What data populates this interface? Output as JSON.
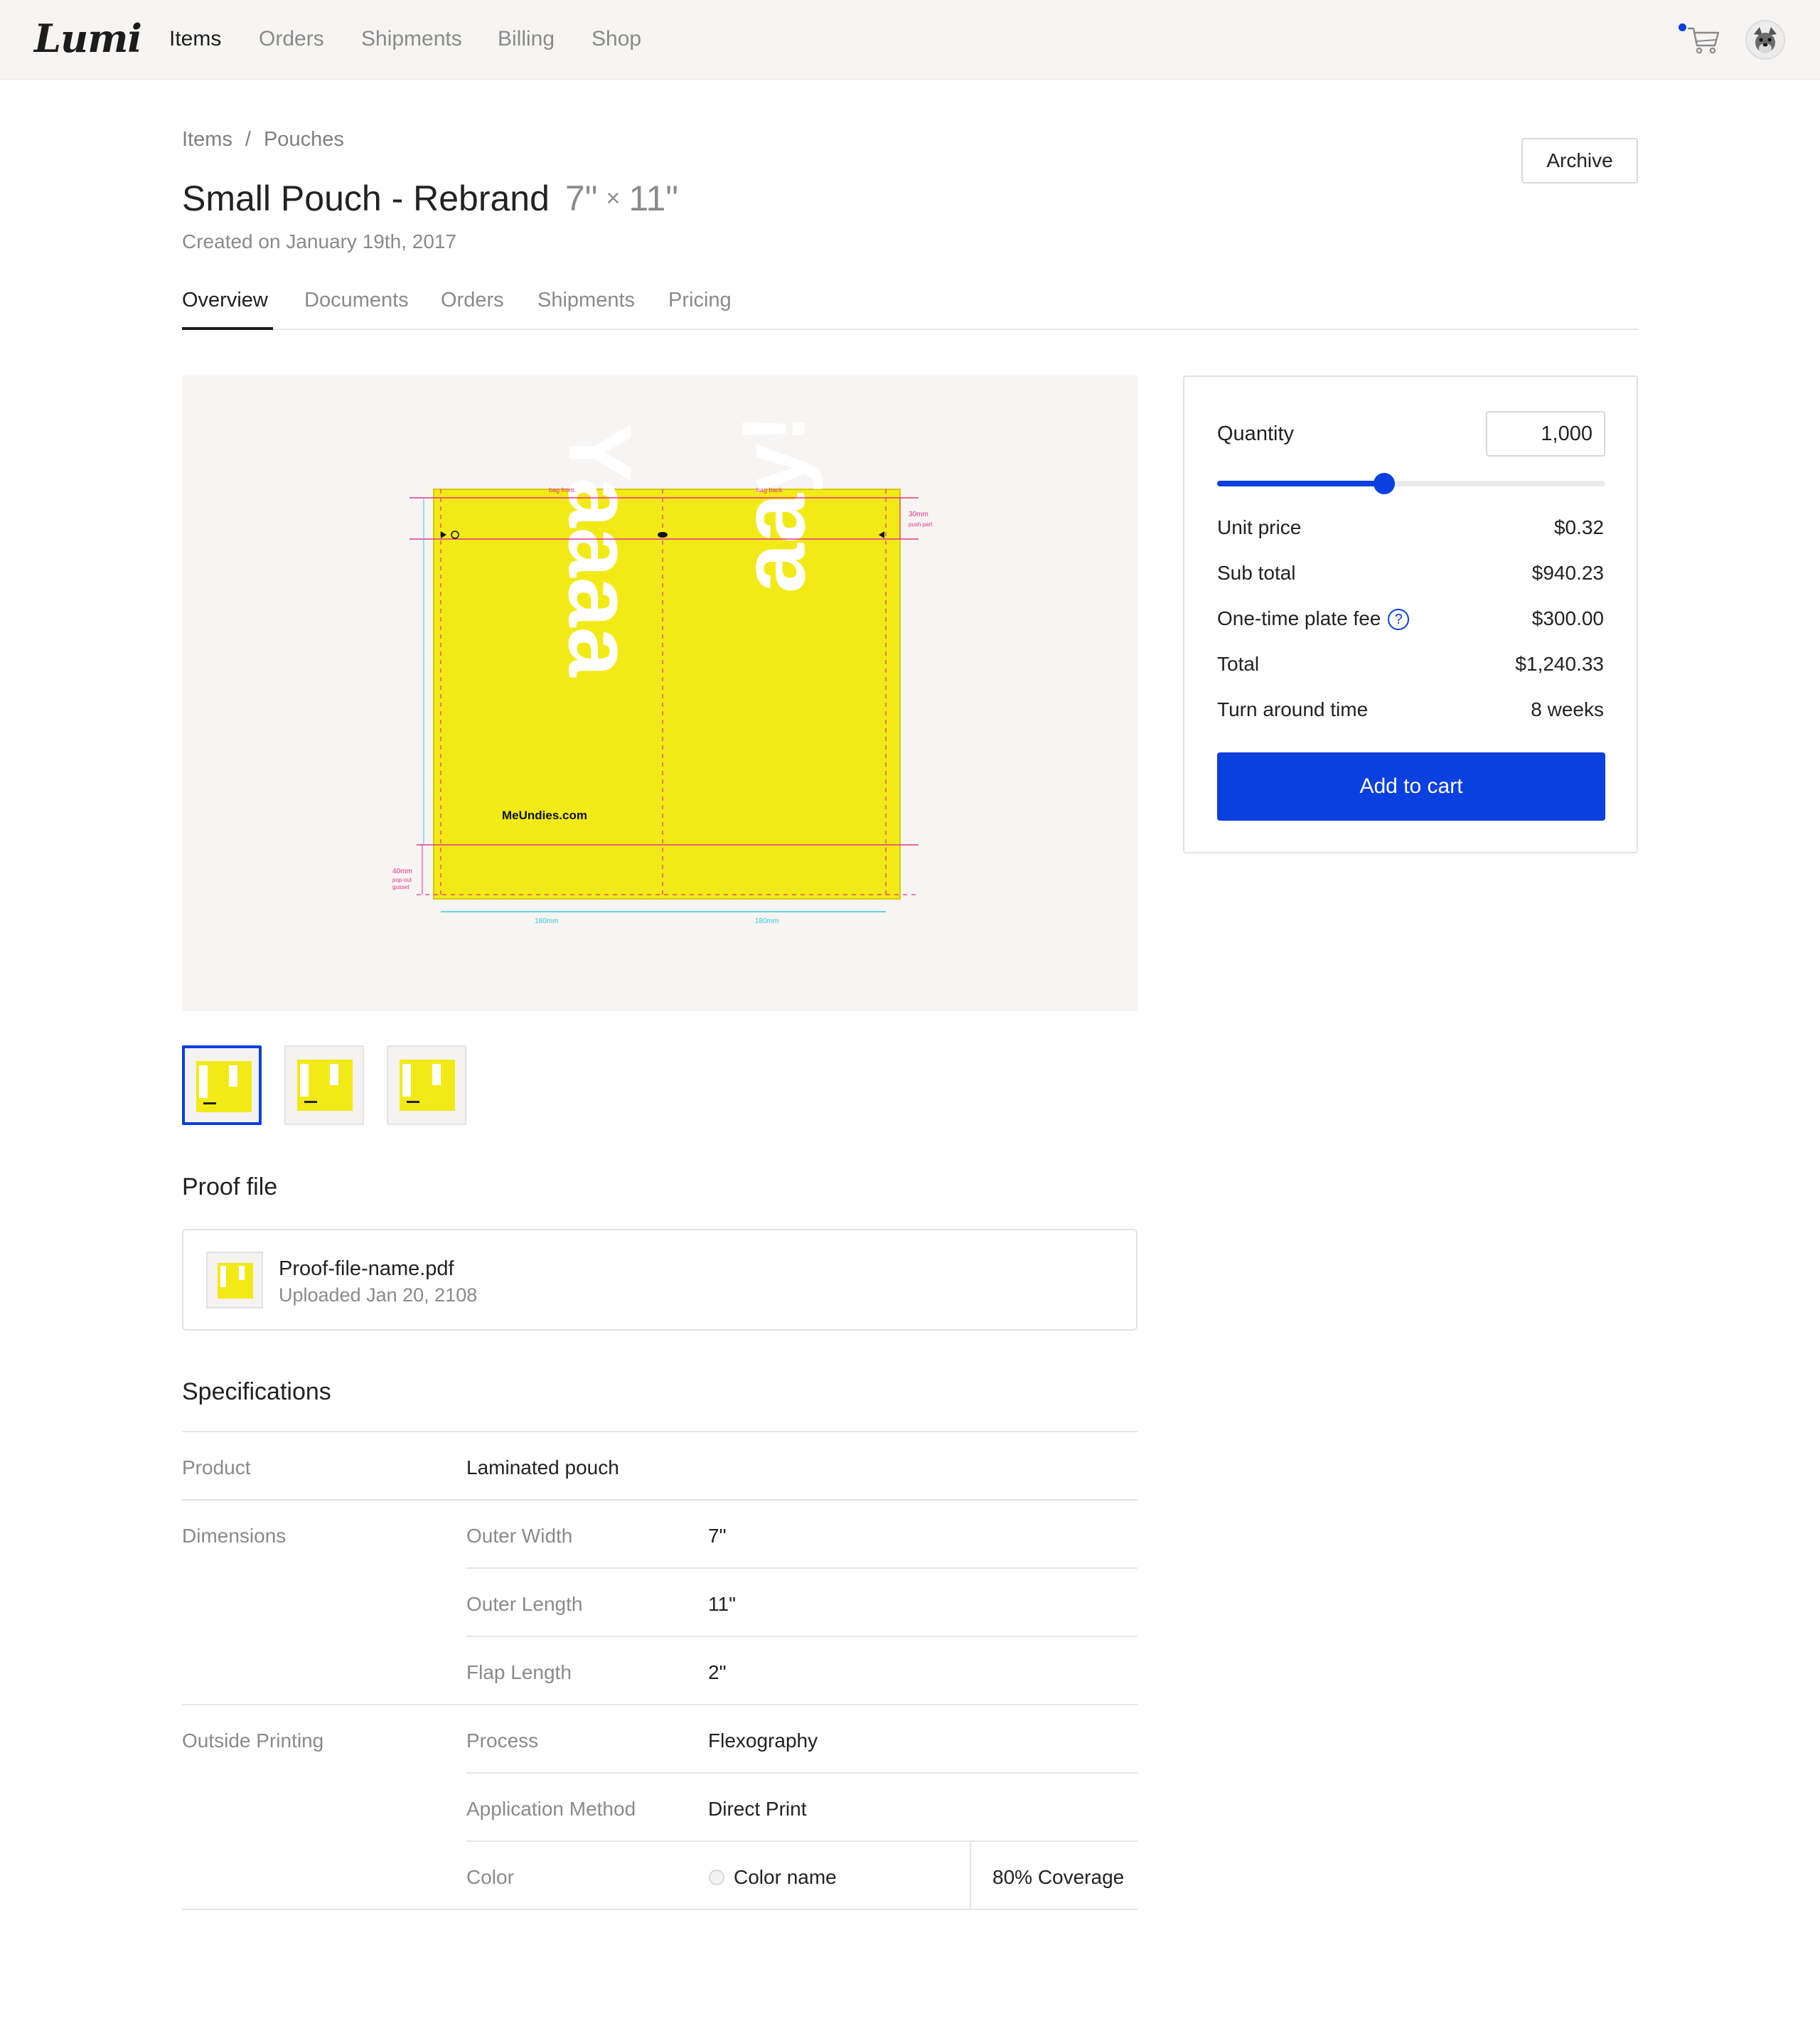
{
  "app": {
    "logo": "Lumi"
  },
  "nav": [
    {
      "label": "Items",
      "active": true
    },
    {
      "label": "Orders",
      "active": false
    },
    {
      "label": "Shipments",
      "active": false
    },
    {
      "label": "Billing",
      "active": false
    },
    {
      "label": "Shop",
      "active": false
    }
  ],
  "header": {
    "breadcrumb": [
      "Items",
      "Pouches"
    ],
    "title": "Small Pouch - Rebrand",
    "width": "7\"",
    "length": "11\"",
    "times": "×",
    "created": "Created on January 19th, 2017",
    "archive_label": "Archive"
  },
  "tabs": [
    "Overview",
    "Documents",
    "Orders",
    "Shipments",
    "Pricing"
  ],
  "preview": {
    "front_word": "Yaaaa",
    "back_word": "aay!",
    "brand": "MeUndies.com",
    "dieline_labels": {
      "bag_front": "bag front",
      "bag_back": "bag back",
      "push_part_mm": "30mm",
      "push_part": "push part",
      "gusset_mm": "40mm",
      "gusset_1": "pop-out",
      "gusset_2": "gusset",
      "panel_width": "180mm",
      "panel_width_2": "180mm"
    },
    "thumbnails": 3,
    "selected_thumbnail": 0
  },
  "proof": {
    "heading": "Proof file",
    "file_name": "Proof-file-name.pdf",
    "uploaded": "Uploaded Jan 20, 2108"
  },
  "specs": {
    "heading": "Specifications",
    "product_label": "Product",
    "product_value": "Laminated pouch",
    "dimensions_label": "Dimensions",
    "outer_width_label": "Outer Width",
    "outer_width_value": "7\"",
    "outer_length_label": "Outer Length",
    "outer_length_value": "11\"",
    "flap_length_label": "Flap Length",
    "flap_length_value": "2\"",
    "printing_label": "Outside Printing",
    "process_label": "Process",
    "process_value": "Flexography",
    "method_label": "Application Method",
    "method_value": "Direct Print",
    "color_label": "Color",
    "color_value": "Color name",
    "coverage_value": "80% Coverage"
  },
  "pricing": {
    "quantity_label": "Quantity",
    "quantity_value": "1,000",
    "slider_fraction": 0.43,
    "unit_price_label": "Unit price",
    "unit_price_value": "$0.32",
    "subtotal_label": "Sub total",
    "subtotal_value": "$940.23",
    "plate_fee_label": "One-time plate fee",
    "plate_fee_value": "$300.00",
    "total_label": "Total",
    "total_value": "$1,240.33",
    "turnaround_label": "Turn around time",
    "turnaround_value": "8 weeks",
    "add_to_cart_label": "Add to cart"
  },
  "colors": {
    "accent": "#0a3fe0",
    "pouch_yellow": "#f2ea16",
    "dieline_pink": "#e8318a",
    "dimension_cyan": "#3cc7e0"
  },
  "icons": {
    "cart": "shopping-cart-icon",
    "help": "question-circle-icon",
    "avatar": "user-avatar"
  }
}
